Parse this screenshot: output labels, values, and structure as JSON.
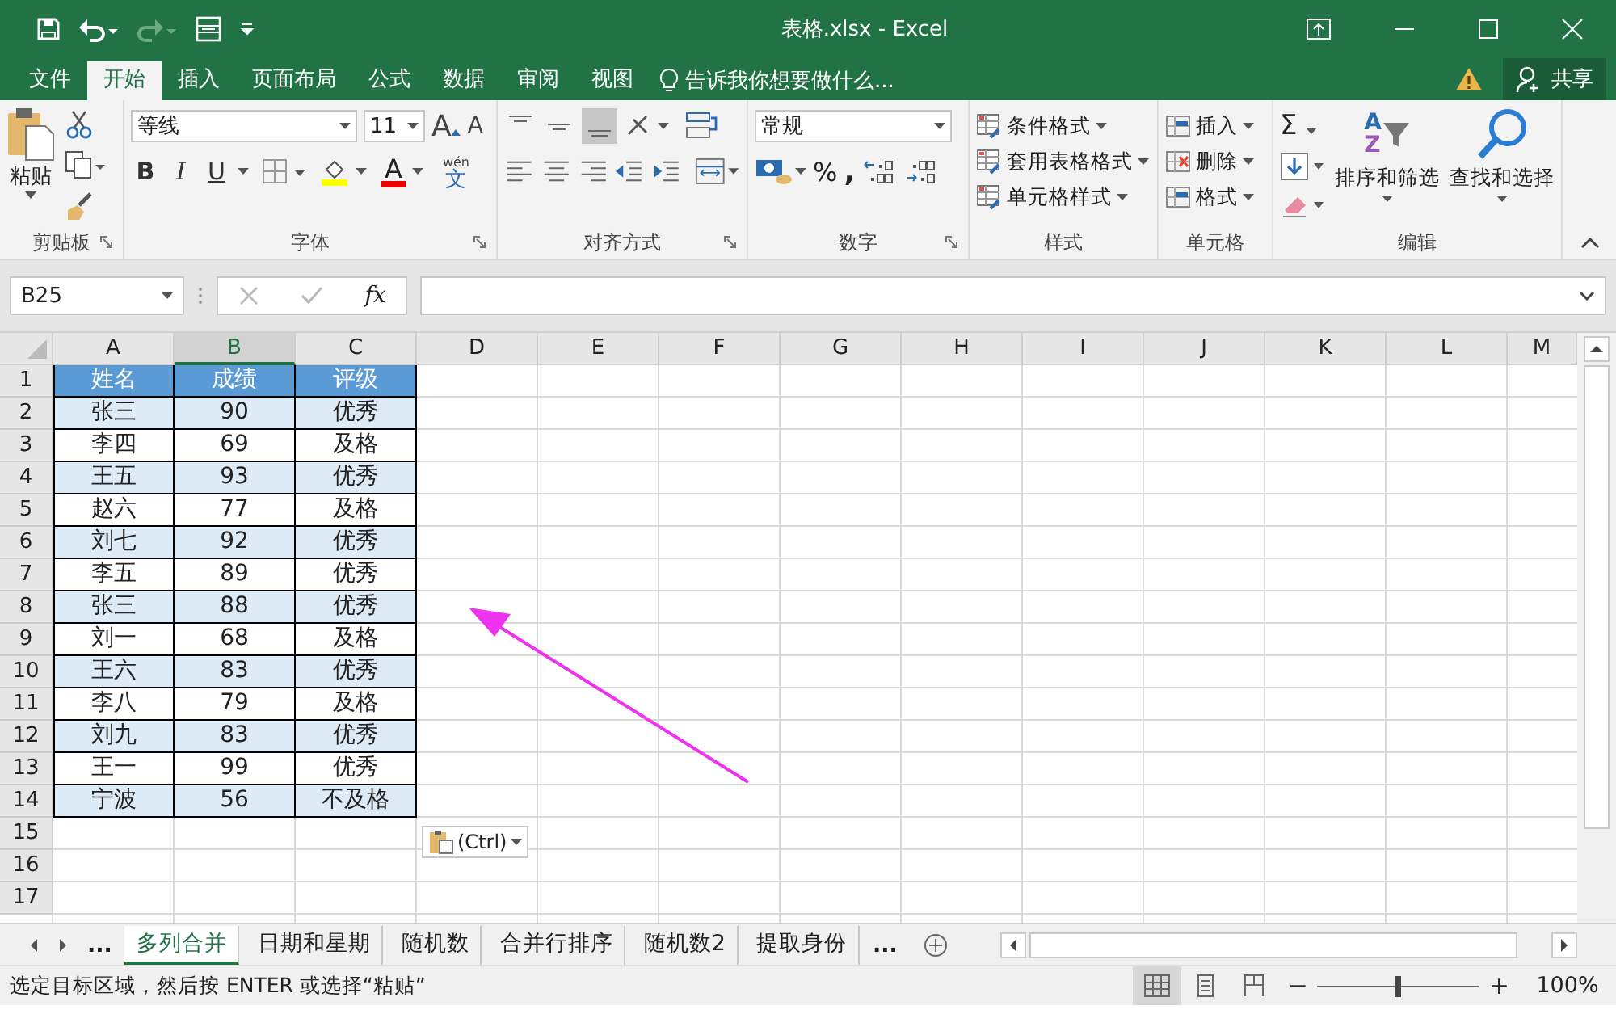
{
  "window": {
    "title": "表格.xlsx - Excel"
  },
  "ribbon_tabs": [
    {
      "label": "文件",
      "selected": false
    },
    {
      "label": "开始",
      "selected": true
    },
    {
      "label": "插入",
      "selected": false
    },
    {
      "label": "页面布局",
      "selected": false
    },
    {
      "label": "公式",
      "selected": false
    },
    {
      "label": "数据",
      "selected": false
    },
    {
      "label": "审阅",
      "selected": false
    },
    {
      "label": "视图",
      "selected": false
    }
  ],
  "tell_me": "告诉我你想要做什么...",
  "share": "共享",
  "ribbon": {
    "paste": "粘贴",
    "font_name": "等线",
    "font_size": "11",
    "grow_font": "A",
    "shrink_font": "A",
    "bold": "B",
    "italic": "I",
    "underline": "U",
    "font_color": "A",
    "phonetic_top": "wén",
    "phonetic_char": "文",
    "number_format": "常规",
    "percent": "%",
    "comma": ",",
    "styles": [
      "条件格式",
      "套用表格格式",
      "单元格样式"
    ],
    "cells": [
      "插入",
      "删除",
      "格式"
    ],
    "autosum": "Σ",
    "sort_letters": [
      "A",
      "Z"
    ],
    "sort": "排序和筛选",
    "find": "查找和选择",
    "groups": [
      "剪贴板",
      "字体",
      "对齐方式",
      "数字",
      "样式",
      "单元格",
      "编辑"
    ]
  },
  "name_box": "B25",
  "fx": "fx",
  "columns": [
    {
      "label": "A",
      "selected": false
    },
    {
      "label": "B",
      "selected": true
    },
    {
      "label": "C",
      "selected": false
    },
    {
      "label": "D",
      "selected": false
    },
    {
      "label": "E",
      "selected": false
    },
    {
      "label": "F",
      "selected": false
    },
    {
      "label": "G",
      "selected": false
    },
    {
      "label": "H",
      "selected": false
    },
    {
      "label": "I",
      "selected": false
    },
    {
      "label": "J",
      "selected": false
    },
    {
      "label": "K",
      "selected": false
    },
    {
      "label": "L",
      "selected": false
    },
    {
      "label": "M",
      "selected": false
    }
  ],
  "table": {
    "header": [
      "姓名",
      "成绩",
      "评级"
    ],
    "rows": [
      {
        "cells": [
          "张三",
          "90",
          "优秀"
        ],
        "shaded": true
      },
      {
        "cells": [
          "李四",
          "69",
          "及格"
        ],
        "shaded": false
      },
      {
        "cells": [
          "王五",
          "93",
          "优秀"
        ],
        "shaded": true
      },
      {
        "cells": [
          "赵六",
          "77",
          "及格"
        ],
        "shaded": false
      },
      {
        "cells": [
          "刘七",
          "92",
          "优秀"
        ],
        "shaded": true
      },
      {
        "cells": [
          "李五",
          "89",
          "优秀"
        ],
        "shaded": false
      },
      {
        "cells": [
          "张三",
          "88",
          "优秀"
        ],
        "shaded": true
      },
      {
        "cells": [
          "刘一",
          "68",
          "及格"
        ],
        "shaded": false
      },
      {
        "cells": [
          "王六",
          "83",
          "优秀"
        ],
        "shaded": true
      },
      {
        "cells": [
          "李八",
          "79",
          "及格"
        ],
        "shaded": false
      },
      {
        "cells": [
          "刘九",
          "83",
          "优秀"
        ],
        "shaded": true
      },
      {
        "cells": [
          "王一",
          "99",
          "优秀"
        ],
        "shaded": false
      },
      {
        "cells": [
          "宁波",
          "56",
          "不及格"
        ],
        "shaded": true
      }
    ]
  },
  "row_numbers": [
    "1",
    "2",
    "3",
    "4",
    "5",
    "6",
    "7",
    "8",
    "9",
    "10",
    "11",
    "12",
    "13",
    "14",
    "15",
    "16",
    "17"
  ],
  "paste_options": "(Ctrl)",
  "sheet_more_left": "...",
  "sheet_tabs": [
    {
      "label": "多列合并",
      "selected": true
    },
    {
      "label": "日期和星期",
      "selected": false
    },
    {
      "label": "随机数",
      "selected": false
    },
    {
      "label": "合并行排序",
      "selected": false
    },
    {
      "label": "随机数2",
      "selected": false
    },
    {
      "label": "提取身份",
      "selected": false
    }
  ],
  "sheet_more_right": "...",
  "status": "选定目标区域，然后按 ENTER 或选择“粘贴”",
  "views": [
    {
      "selected": true
    },
    {
      "selected": false
    },
    {
      "selected": false
    }
  ],
  "zoom": {
    "minus": "−",
    "plus": "+",
    "level": 0.5,
    "reading": "100%"
  }
}
